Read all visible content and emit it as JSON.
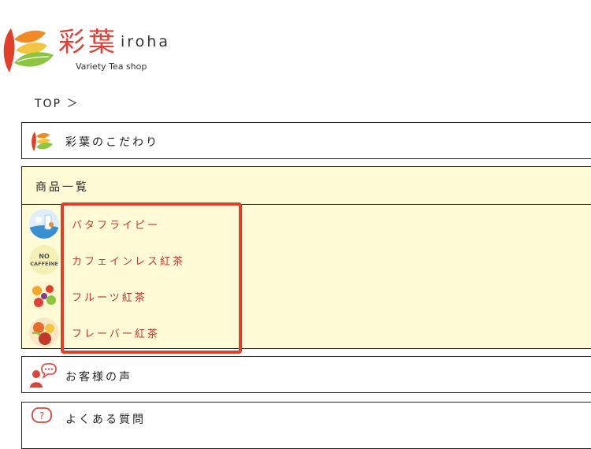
{
  "brand": {
    "name_jp": "彩葉",
    "name_en": "iroha",
    "tagline": "Variety Tea shop"
  },
  "breadcrumb": "TOP ＞",
  "menu": {
    "commitment_label": "彩葉のこだわり",
    "products": {
      "header_label": "商品一覧",
      "items": [
        {
          "label": "バタフライピー",
          "icon": "butterfly-pea-thumb"
        },
        {
          "label": "カフェインレス紅茶",
          "icon": "no-caffeine-thumb",
          "thumb_text": "NO CAFFEINE"
        },
        {
          "label": "フルーツ紅茶",
          "icon": "fruit-tea-thumb"
        },
        {
          "label": "フレーバー紅茶",
          "icon": "flavor-tea-thumb"
        }
      ]
    },
    "voice_label": "お客様の声",
    "faq_label": "よくある質問"
  },
  "colors": {
    "accent": "#c0392b",
    "highlight_border": "#e0402a",
    "products_bg": "#fffbd6"
  }
}
